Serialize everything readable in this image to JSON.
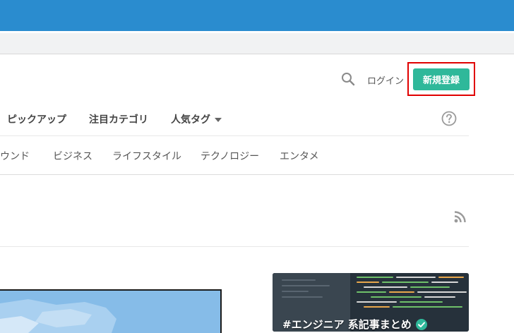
{
  "header": {
    "login_label": "ログイン",
    "signup_label": "新規登録",
    "accent_color": "#2fb89a",
    "icons": [
      "search-icon",
      "help-icon",
      "rss-icon"
    ]
  },
  "nav": {
    "main": [
      {
        "label": "ピックアップ"
      },
      {
        "label": "注目カテゴリ"
      },
      {
        "label": "人気タグ"
      }
    ],
    "categories": [
      {
        "label": "サウンド"
      },
      {
        "label": "ビジネス"
      },
      {
        "label": "ライフスタイル"
      },
      {
        "label": "テクノロジー"
      },
      {
        "label": "エンタメ"
      }
    ]
  },
  "cards": {
    "right_title": "#エンジニア 系記事まとめ"
  }
}
